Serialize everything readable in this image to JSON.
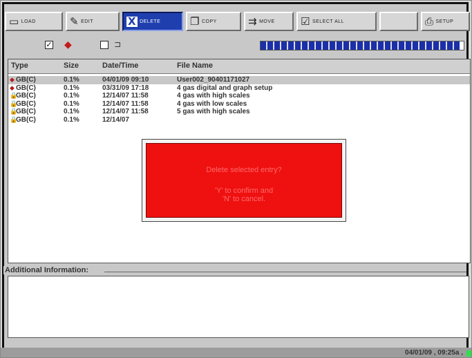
{
  "toolbar": {
    "buttons": [
      {
        "label": "LOAD",
        "icon": "folder-icon",
        "glyph": "▭"
      },
      {
        "label": "EDIT",
        "icon": "edit-icon",
        "glyph": "✎"
      },
      {
        "label": "DELETE",
        "icon": "delete-icon",
        "glyph": "X"
      },
      {
        "label": "COPY",
        "icon": "copy-icon",
        "glyph": "❐"
      },
      {
        "label": "MOVE",
        "icon": "move-icon",
        "glyph": "⇉"
      },
      {
        "label": "SELECT ALL",
        "icon": "select-all-icon",
        "glyph": "☑"
      },
      {
        "label": "",
        "icon": "blank-icon",
        "glyph": ""
      },
      {
        "label": "SETUP",
        "icon": "printer-icon",
        "glyph": "⎙"
      }
    ],
    "active_button": "DELETE"
  },
  "options": {
    "checkbox1_checked": true,
    "checkbox2_checked": false,
    "progress_fraction": 0.98
  },
  "table": {
    "headers": {
      "type": "Type",
      "size": "Size",
      "datetime": "Date/Time",
      "filename": "File Name"
    },
    "rows": [
      {
        "type": "GB(C)",
        "size": "0.1%",
        "datetime": "04/01/09 09:10",
        "filename": "User002_90401171027",
        "selected": true,
        "icon": "diamond"
      },
      {
        "type": "GB(C)",
        "size": "0.1%",
        "datetime": "03/31/09 17:18",
        "filename": "4 gas digital and graph setup",
        "selected": false,
        "icon": "diamond"
      },
      {
        "type": "GB(C)",
        "size": "0.1%",
        "datetime": "12/14/07 11:58",
        "filename": "4 gas with high scales",
        "selected": false,
        "icon": "lock"
      },
      {
        "type": "GB(C)",
        "size": "0.1%",
        "datetime": "12/14/07 11:58",
        "filename": "4 gas with low scales",
        "selected": false,
        "icon": "lock"
      },
      {
        "type": "GB(C)",
        "size": "0.1%",
        "datetime": "12/14/07 11:58",
        "filename": "5 gas with high scales",
        "selected": false,
        "icon": "lock"
      },
      {
        "type": "GB(C)",
        "size": "0.1%",
        "datetime": "12/14/07",
        "filename": "",
        "selected": false,
        "icon": "lock"
      }
    ]
  },
  "dialog": {
    "line1": "Delete selected entry?",
    "line2": "'Y' to confirm and",
    "line3": "'N' to cancel."
  },
  "info": {
    "title": "Additional Information:"
  },
  "status": {
    "datetime": "04/01/09 , 09:25a ,"
  },
  "colors": {
    "dialog_red": "#ef1010",
    "active_blue": "#1f3fae",
    "progress_blue": "#1a2fa8",
    "led_green": "#2ee04a"
  }
}
